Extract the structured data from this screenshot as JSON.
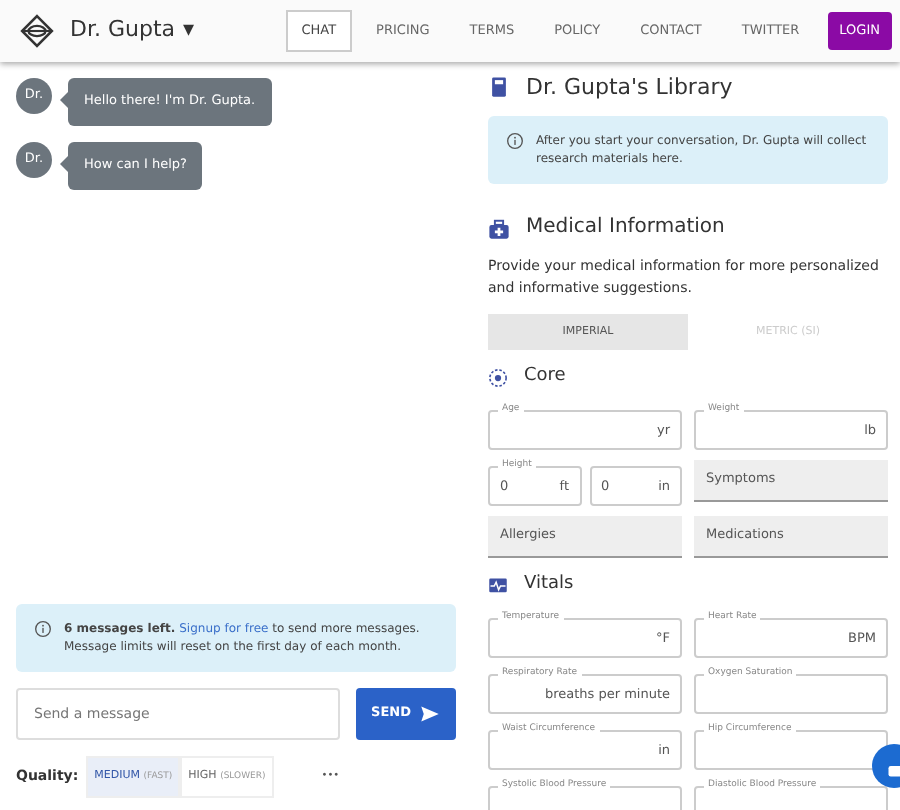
{
  "brand": {
    "name": "Dr. Gupta",
    "caret": "▾"
  },
  "nav": [
    {
      "label": "CHAT",
      "selected": true
    },
    {
      "label": "PRICING",
      "selected": false
    },
    {
      "label": "TERMS",
      "selected": false
    },
    {
      "label": "POLICY",
      "selected": false
    },
    {
      "label": "CONTACT",
      "selected": false
    },
    {
      "label": "TWITTER",
      "selected": false
    }
  ],
  "login": "LOGIN",
  "messages": [
    {
      "avatar": "Dr.",
      "text": "Hello there! I'm Dr. Gupta."
    },
    {
      "avatar": "Dr.",
      "text": "How can I help?"
    }
  ],
  "limit_alert": {
    "bold": "6 messages left.",
    "link": "Signup for free",
    "rest": "to send more messages. Message limits will reset on the first day of each month."
  },
  "message_input": {
    "placeholder": "Send a message"
  },
  "send": "SEND",
  "quality": {
    "label": "Quality:",
    "options": [
      {
        "label": "MEDIUM",
        "note": "(FAST)",
        "selected": true
      },
      {
        "label": "HIGH",
        "note": "(SLOWER)",
        "selected": false
      }
    ],
    "more": "•••"
  },
  "library": {
    "title": "Dr. Gupta's Library",
    "info": "After you start your conversation, Dr. Gupta will collect research materials here."
  },
  "medical": {
    "title": "Medical Information",
    "description": "Provide your medical information for more personalized and informative suggestions.",
    "units": [
      {
        "label": "IMPERIAL",
        "selected": true
      },
      {
        "label": "METRIC (SI)",
        "selected": false
      }
    ]
  },
  "sections": [
    {
      "title": "Core",
      "fields": [
        {
          "kind": "outlined",
          "label": "Age",
          "parts": [
            {
              "unit": "yr"
            }
          ]
        },
        {
          "kind": "outlined",
          "label": "Weight",
          "parts": [
            {
              "unit": "lb"
            }
          ]
        },
        {
          "kind": "outlined",
          "label": "Height",
          "parts": [
            {
              "value": "0",
              "unit": "ft"
            },
            {
              "value": "0",
              "unit": "in"
            }
          ]
        },
        {
          "kind": "filled",
          "label": "Symptoms"
        },
        {
          "kind": "filled",
          "label": "Allergies"
        },
        {
          "kind": "filled",
          "label": "Medications"
        }
      ]
    },
    {
      "title": "Vitals",
      "fields": [
        {
          "kind": "outlined",
          "label": "Temperature",
          "parts": [
            {
              "unit": "°F"
            }
          ]
        },
        {
          "kind": "outlined",
          "label": "Heart Rate",
          "parts": [
            {
              "unit": "BPM"
            }
          ]
        },
        {
          "kind": "outlined",
          "label": "Respiratory Rate",
          "parts": [
            {
              "unit": "breaths per minute"
            }
          ]
        },
        {
          "kind": "outlined",
          "label": "Oxygen Saturation"
        },
        {
          "kind": "outlined",
          "label": "Waist Circumference",
          "parts": [
            {
              "unit": "in"
            }
          ]
        },
        {
          "kind": "outlined",
          "label": "Hip Circumference"
        },
        {
          "kind": "outlined",
          "label": "Systolic Blood Pressure"
        },
        {
          "kind": "outlined",
          "label": "Diastolic Blood Pressure"
        }
      ]
    }
  ]
}
